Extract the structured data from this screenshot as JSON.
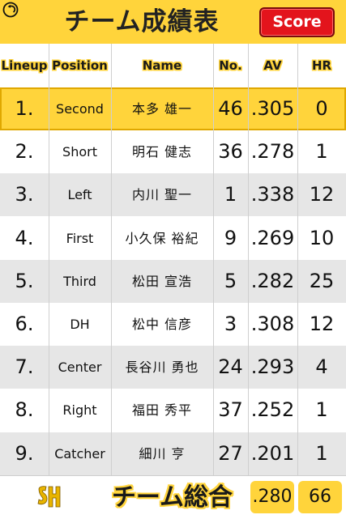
{
  "header": {
    "title": "チーム成績表",
    "score_button": "Score",
    "back_icon": "back-arrow-icon"
  },
  "columns": {
    "lineup": "Lineup",
    "position": "Position",
    "name": "Name",
    "number": "No.",
    "av": "AV",
    "hr": "HR"
  },
  "rows": [
    {
      "lineup": "1.",
      "position": "Second",
      "name": "本多 雄一",
      "number": "46",
      "av": ".305",
      "hr": "0",
      "highlighted": true
    },
    {
      "lineup": "2.",
      "position": "Short",
      "name": "明石 健志",
      "number": "36",
      "av": ".278",
      "hr": "1",
      "highlighted": false
    },
    {
      "lineup": "3.",
      "position": "Left",
      "name": "内川 聖一",
      "number": "1",
      "av": ".338",
      "hr": "12",
      "highlighted": false
    },
    {
      "lineup": "4.",
      "position": "First",
      "name": "小久保 裕紀",
      "number": "9",
      "av": ".269",
      "hr": "10",
      "highlighted": false
    },
    {
      "lineup": "5.",
      "position": "Third",
      "name": "松田 宣浩",
      "number": "5",
      "av": ".282",
      "hr": "25",
      "highlighted": false
    },
    {
      "lineup": "6.",
      "position": "DH",
      "name": "松中 信彦",
      "number": "3",
      "av": ".308",
      "hr": "12",
      "highlighted": false
    },
    {
      "lineup": "7.",
      "position": "Center",
      "name": "長谷川 勇也",
      "number": "24",
      "av": ".293",
      "hr": "4",
      "highlighted": false
    },
    {
      "lineup": "8.",
      "position": "Right",
      "name": "福田 秀平",
      "number": "37",
      "av": ".252",
      "hr": "1",
      "highlighted": false
    },
    {
      "lineup": "9.",
      "position": "Catcher",
      "name": "細川 亨",
      "number": "27",
      "av": ".201",
      "hr": "1",
      "highlighted": false
    }
  ],
  "footer": {
    "team_total_label": "チーム総合",
    "total_av": ".280",
    "total_hr": "66",
    "logo_icon": "team-logo-icon"
  },
  "colors": {
    "accent_yellow": "#ffd43b",
    "score_red": "#e3141c",
    "row_grey": "#e6e6e6"
  }
}
